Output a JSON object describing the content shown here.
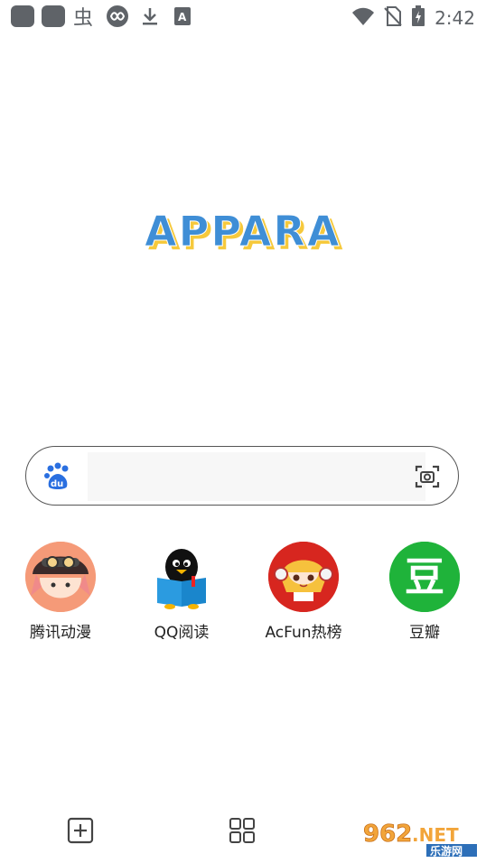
{
  "status_bar": {
    "time": "2:42",
    "left_icons": [
      "app-square-icon",
      "app-square-icon",
      "bug-icon",
      "infinity-icon",
      "download-icon",
      "text-a-icon"
    ],
    "right_icons": [
      "wifi-icon",
      "no-sim-icon",
      "battery-charging-icon"
    ]
  },
  "logo": {
    "text": "APPARA"
  },
  "search": {
    "value": "",
    "placeholder": "",
    "left_icon": "baidu-paw-icon",
    "right_icon": "camera-scan-icon"
  },
  "quick_apps": [
    {
      "label": "腾讯动漫",
      "icon": "tencent-comic-icon"
    },
    {
      "label": "QQ阅读",
      "icon": "qq-reading-icon"
    },
    {
      "label": "AcFun热榜",
      "icon": "acfun-icon"
    },
    {
      "label": "豆瓣",
      "icon": "douban-icon",
      "glyph": "豆"
    }
  ],
  "bottom_nav": {
    "left_icon": "add-tab-icon",
    "center_icon": "grid-apps-icon"
  },
  "watermark": {
    "text_a": "962",
    "text_b": ".NET",
    "sub": "乐游网"
  },
  "colors": {
    "logo_blue": "#3f8ed6",
    "logo_yellow": "#f6c93c",
    "douban_green": "#1fb33a",
    "acfun_red": "#d7261f",
    "baidu_blue": "#2a6fe0"
  }
}
